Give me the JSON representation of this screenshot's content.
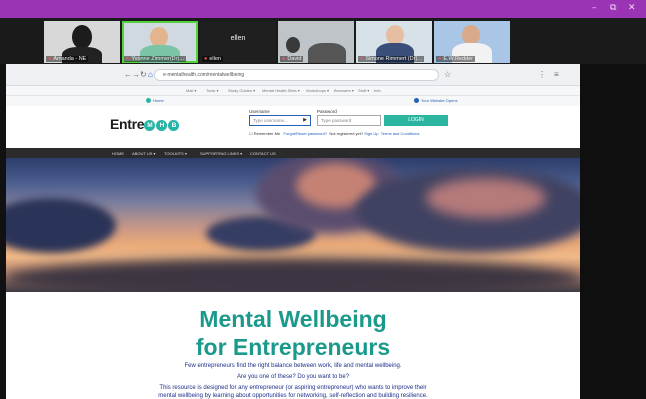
{
  "zoom": {
    "window_controls": [
      "–",
      "⧉",
      "✕"
    ],
    "participants": [
      {
        "name": "Amanda - NE",
        "active": false
      },
      {
        "name": "Yvonne Zimmer(Dr)...",
        "active": true
      },
      {
        "name": "ellen",
        "active": false,
        "center_label": "ellen"
      },
      {
        "name": "Ben Bol",
        "active": false
      },
      {
        "name": "David",
        "active": false
      },
      {
        "name": "Simone Rimmert (Dr)...",
        "active": false
      },
      {
        "name": "E.W.Redder",
        "active": false
      }
    ]
  },
  "browser": {
    "nav_icons": [
      "←",
      "→",
      "↻",
      "⌂"
    ],
    "url": "e-mentalhealth.com/mentalwellbeing",
    "bookmarks": [
      "Mail ▾",
      "Tools ▾",
      "Study Guides ▾",
      "Mental Health Sites ▾",
      "Workshops ▾",
      "Browsers ▾",
      "Stuff ▾",
      "Info"
    ],
    "ext_left": "Home",
    "ext_right": "Your Website Opens"
  },
  "site": {
    "logo_prefix": "Entre",
    "logo_letters": [
      "M",
      "H",
      "B"
    ],
    "username_label": "Username",
    "username_placeholder": "Type username...",
    "password_label": "Password",
    "password_placeholder": "Type password",
    "login_button": "LOGIN",
    "remember_me": "Remember Me",
    "forgot_password": "Forgot/Reset password?",
    "not_registered": "Not registered yet?",
    "sign_up": "Sign Up",
    "terms": "Terms and Conditions",
    "nav": [
      "HOME",
      "ABOUT US ▾",
      "TOOLKITS ▾",
      "SUPPORTING LINKS ▾",
      "CONTACT US"
    ]
  },
  "content": {
    "title_line1": "Mental Wellbeing",
    "title_line2": "for Entrepreneurs",
    "para1": "Few entrepreneurs find the right balance between work, life and mental wellbeing.",
    "para2": "Are you one of these? Do you want to be?",
    "para3": "This resource is designed for any entrepreneur (or aspiring entrepreneur) who wants to improve their",
    "para4": "mental wellbeing by learning about opportunities for networking, self-reflection and building resilience."
  },
  "colors": {
    "zoom_bar": "#9b33b5",
    "accent_teal": "#1b9a8c",
    "login_button": "#2bb5a0",
    "body_text": "#1d2f8a",
    "active_speaker": "#54d13e"
  }
}
